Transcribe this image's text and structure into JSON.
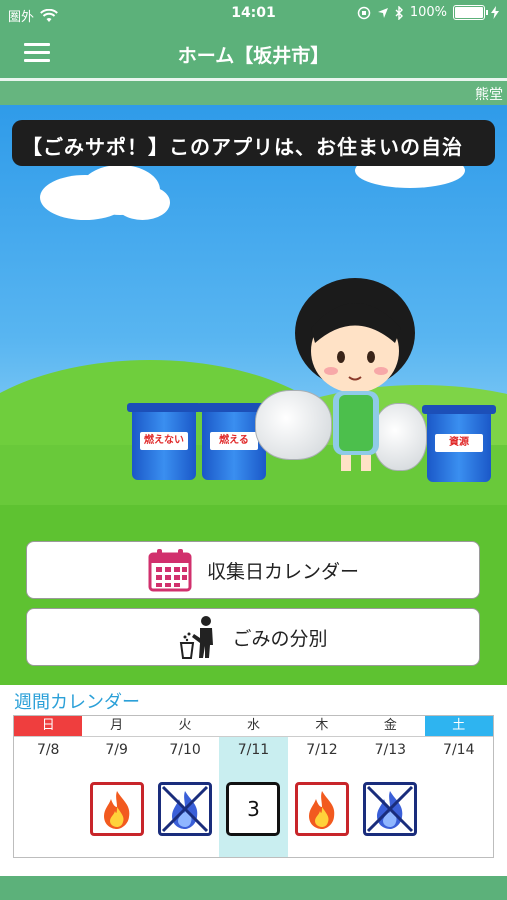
{
  "status_bar": {
    "carrier": "圏外",
    "time": "14:01",
    "battery": "100%"
  },
  "nav": {
    "title": "ホーム【坂井市】"
  },
  "ticker": {
    "text": "熊堂"
  },
  "banner": {
    "text": "【ごみサポ！】このアプリは、お住まいの自治"
  },
  "illustration": {
    "bins": [
      {
        "label": "燃えない"
      },
      {
        "label": "燃える"
      },
      {
        "label": "資源"
      }
    ]
  },
  "actions": {
    "calendar_label": "収集日カレンダー",
    "sorting_label": "ごみの分別"
  },
  "weekly": {
    "title": "週間カレンダー",
    "days": [
      {
        "dow": "日",
        "date": "7/8",
        "icon": "none",
        "header_color": "#ef3e3e",
        "header_text": "#ffffff"
      },
      {
        "dow": "月",
        "date": "7/9",
        "icon": "burnable",
        "header_color": "#ffffff",
        "header_text": "#333333"
      },
      {
        "dow": "火",
        "date": "7/10",
        "icon": "nonburnable",
        "header_color": "#ffffff",
        "header_text": "#333333"
      },
      {
        "dow": "水",
        "date": "7/11",
        "icon": "number",
        "number": "3",
        "header_color": "#ffffff",
        "header_text": "#333333",
        "highlight": "#c9eef0"
      },
      {
        "dow": "木",
        "date": "7/12",
        "icon": "burnable",
        "header_color": "#ffffff",
        "header_text": "#333333"
      },
      {
        "dow": "金",
        "date": "7/13",
        "icon": "nonburnable",
        "header_color": "#ffffff",
        "header_text": "#333333"
      },
      {
        "dow": "土",
        "date": "7/14",
        "icon": "none",
        "header_color": "#2eb4f0",
        "header_text": "#ffffff"
      }
    ]
  },
  "colors": {
    "primary_green": "#5cb17a",
    "accent_blue": "#2ba0d8"
  }
}
